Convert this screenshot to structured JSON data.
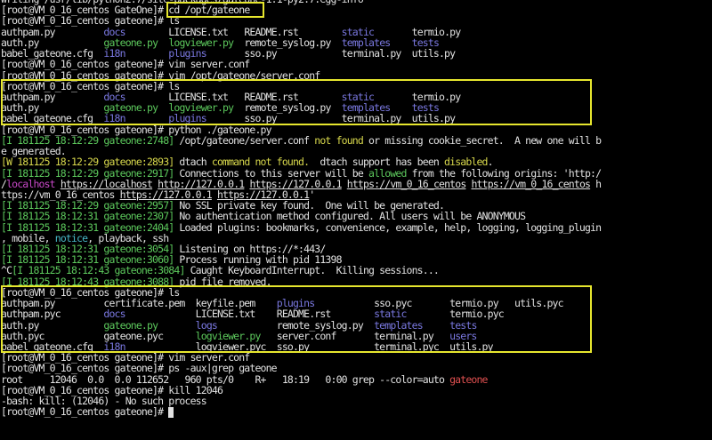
{
  "terminal": {
    "lines": [
      [
        {
          "t": "writing /usr/lib/python2.7/site-packages/gateone-1.1-py2.7.egg-info",
          "c": "w"
        }
      ],
      [
        {
          "t": "[root@VM_0_16_centos GateOne]# ",
          "c": "w"
        },
        {
          "t": "cd /opt/gateone",
          "c": "w"
        }
      ],
      [
        {
          "t": "[root@VM_0_16_centos gateone]# ls",
          "c": "w"
        }
      ],
      [
        {
          "t": "authpam.py         ",
          "c": "w"
        },
        {
          "t": "docs",
          "c": "b"
        },
        {
          "t": "        LICENSE.txt   README.rst        ",
          "c": "w"
        },
        {
          "t": "static",
          "c": "b"
        },
        {
          "t": "       termio.py",
          "c": "w"
        }
      ],
      [
        {
          "t": "auth.py            ",
          "c": "w"
        },
        {
          "t": "gateone.py",
          "c": "g"
        },
        {
          "t": "  ",
          "c": "w"
        },
        {
          "t": "logviewer.py",
          "c": "g"
        },
        {
          "t": "  remote_syslog.py  ",
          "c": "w"
        },
        {
          "t": "templates",
          "c": "b"
        },
        {
          "t": "    ",
          "c": "w"
        },
        {
          "t": "tests",
          "c": "b"
        }
      ],
      [
        {
          "t": "babel_gateone.cfg  ",
          "c": "w"
        },
        {
          "t": "i18n",
          "c": "b"
        },
        {
          "t": "        ",
          "c": "w"
        },
        {
          "t": "plugins",
          "c": "b"
        },
        {
          "t": "       sso.py            terminal.py  utils.py",
          "c": "w"
        }
      ],
      [
        {
          "t": "[root@VM_0_16_centos gateone]# vim server.conf",
          "c": "w"
        }
      ],
      [
        {
          "t": "[root@VM_0_16_centos gateone]# vim /opt/gateone/server.conf",
          "c": "w"
        }
      ],
      [
        {
          "t": "[root@VM_0_16_centos gateone]# ls",
          "c": "w"
        }
      ],
      [
        {
          "t": "authpam.py         ",
          "c": "w"
        },
        {
          "t": "docs",
          "c": "b"
        },
        {
          "t": "        LICENSE.txt   README.rst        ",
          "c": "w"
        },
        {
          "t": "static",
          "c": "b"
        },
        {
          "t": "       termio.py",
          "c": "w"
        }
      ],
      [
        {
          "t": "auth.py            ",
          "c": "w"
        },
        {
          "t": "gateone.py",
          "c": "g"
        },
        {
          "t": "  ",
          "c": "w"
        },
        {
          "t": "logviewer.py",
          "c": "g"
        },
        {
          "t": "  remote_syslog.py  ",
          "c": "w"
        },
        {
          "t": "templates",
          "c": "b"
        },
        {
          "t": "    ",
          "c": "w"
        },
        {
          "t": "tests",
          "c": "b"
        }
      ],
      [
        {
          "t": "babel_gateone.cfg  ",
          "c": "w"
        },
        {
          "t": "i18n",
          "c": "b"
        },
        {
          "t": "        ",
          "c": "w"
        },
        {
          "t": "plugins",
          "c": "b"
        },
        {
          "t": "       sso.py            terminal.py  utils.py",
          "c": "w"
        }
      ],
      [
        {
          "t": "[root@VM_0_16_centos gateone]# python ./gateone.py",
          "c": "w"
        }
      ],
      [
        {
          "t": "[I 181125 18:12:29 gateone:2748]",
          "c": "g"
        },
        {
          "t": " /opt/gateone/server.conf ",
          "c": "w"
        },
        {
          "t": "not found",
          "c": "y"
        },
        {
          "t": " or missing cookie_secret.  A new one will b",
          "c": "w"
        }
      ],
      [
        {
          "t": "e generated.",
          "c": "w"
        }
      ],
      [
        {
          "t": "[W 181125 18:12:29 gateone:2893]",
          "c": "y"
        },
        {
          "t": " dtach ",
          "c": "w"
        },
        {
          "t": "command not found.",
          "c": "y"
        },
        {
          "t": "  dtach support has been ",
          "c": "w"
        },
        {
          "t": "disabled",
          "c": "y"
        },
        {
          "t": ".",
          "c": "w"
        }
      ],
      [
        {
          "t": "[I 181125 18:12:29 gateone:2917]",
          "c": "g"
        },
        {
          "t": " Connections to this server will be ",
          "c": "w"
        },
        {
          "t": "allowed",
          "c": "g"
        },
        {
          "t": " from the following origins: 'http:/",
          "c": "w"
        }
      ],
      [
        {
          "t": "/",
          "c": "w"
        },
        {
          "t": "localhost",
          "c": "m"
        },
        {
          "t": " ",
          "c": "w"
        },
        {
          "t": "https://localhost",
          "c": "w u"
        },
        {
          "t": " ",
          "c": "w"
        },
        {
          "t": "http://127.0.0.1",
          "c": "w u"
        },
        {
          "t": " ",
          "c": "w"
        },
        {
          "t": "https://127.0.0.1",
          "c": "w u"
        },
        {
          "t": " ",
          "c": "w"
        },
        {
          "t": "https://vm_0_16_centos",
          "c": "w u"
        },
        {
          "t": " ",
          "c": "w"
        },
        {
          "t": "https://vm_0_16_centos",
          "c": "w u"
        },
        {
          "t": " h",
          "c": "w"
        }
      ],
      [
        {
          "t": "ttps://vm_0_16_centos ",
          "c": "w"
        },
        {
          "t": "https://127.0.0.1",
          "c": "w u"
        },
        {
          "t": " ",
          "c": "w"
        },
        {
          "t": "https://127.0.0.1",
          "c": "w u"
        },
        {
          "t": "'",
          "c": "w"
        }
      ],
      [
        {
          "t": "[I 181125 18:12:29 gateone:2957]",
          "c": "g"
        },
        {
          "t": " No SSL private key found.  One will be generated.",
          "c": "w"
        }
      ],
      [
        {
          "t": "[I 181125 18:12:31 gateone:2307]",
          "c": "g"
        },
        {
          "t": " No authentication method configured. All users will be ANONYMOUS",
          "c": "w"
        }
      ],
      [
        {
          "t": "[I 181125 18:12:31 gateone:2404]",
          "c": "g"
        },
        {
          "t": " Loaded plugins: bookmarks, convenience, example, help, logging, logging_plugin",
          "c": "w"
        }
      ],
      [
        {
          "t": ", mobile, ",
          "c": "w"
        },
        {
          "t": "notice",
          "c": "c"
        },
        {
          "t": ", playback, ssh",
          "c": "w"
        }
      ],
      [
        {
          "t": "[I 181125 18:12:31 gateone:3054]",
          "c": "g"
        },
        {
          "t": " Listening on https://*:443/",
          "c": "w"
        }
      ],
      [
        {
          "t": "[I 181125 18:12:31 gateone:3060]",
          "c": "g"
        },
        {
          "t": " Process running with pid 11398",
          "c": "w"
        }
      ],
      [
        {
          "t": "^C",
          "c": "w"
        },
        {
          "t": "[I 181125 18:12:43 gateone:3084]",
          "c": "g"
        },
        {
          "t": " Caught KeyboardInterrupt.  Killing sessions...",
          "c": "w"
        }
      ],
      [
        {
          "t": "[I 181125 18:12:43 gateone:3088]",
          "c": "g"
        },
        {
          "t": " pid file removed.",
          "c": "w"
        }
      ],
      [
        {
          "t": "[root@VM_0_16_centos gateone]# ls",
          "c": "w"
        }
      ],
      [
        {
          "t": "authpam.py         certificate.pem  keyfile.pem    ",
          "c": "w"
        },
        {
          "t": "plugins",
          "c": "b"
        },
        {
          "t": "           sso.pyc       termio.py   utils.pyc",
          "c": "w"
        }
      ],
      [
        {
          "t": "authpam.pyc        ",
          "c": "w"
        },
        {
          "t": "docs",
          "c": "b"
        },
        {
          "t": "             LICENSE.txt    README.rst        ",
          "c": "w"
        },
        {
          "t": "static",
          "c": "b"
        },
        {
          "t": "        termio.pyc",
          "c": "w"
        }
      ],
      [
        {
          "t": "auth.py            ",
          "c": "w"
        },
        {
          "t": "gateone.py",
          "c": "g"
        },
        {
          "t": "       ",
          "c": "w"
        },
        {
          "t": "logs",
          "c": "b"
        },
        {
          "t": "           remote_syslog.py  ",
          "c": "w"
        },
        {
          "t": "templates",
          "c": "b"
        },
        {
          "t": "     ",
          "c": "w"
        },
        {
          "t": "tests",
          "c": "b"
        }
      ],
      [
        {
          "t": "auth.pyc           gateone.pyc      ",
          "c": "w"
        },
        {
          "t": "logviewer.py",
          "c": "g"
        },
        {
          "t": "   server.conf       terminal.py   ",
          "c": "w"
        },
        {
          "t": "users",
          "c": "b"
        }
      ],
      [
        {
          "t": "babel_gateone.cfg  ",
          "c": "w"
        },
        {
          "t": "i18n",
          "c": "b"
        },
        {
          "t": "             logviewer.pyc  sso.py            terminal.pyc  utils.py",
          "c": "w"
        }
      ],
      [
        {
          "t": "[root@VM_0_16_centos gateone]# vim server.conf",
          "c": "w"
        }
      ],
      [
        {
          "t": "[root@VM_0_16_centos gateone]# ps -aux|grep gateone",
          "c": "w"
        }
      ],
      [
        {
          "t": "root     12046  0.0  0.0 112652   960 pts/0    R+   18:19   0:00 grep --color=auto ",
          "c": "w"
        },
        {
          "t": "gateone",
          "c": "r"
        }
      ],
      [
        {
          "t": "[root@VM_0_16_centos gateone]# kill 12046",
          "c": "w"
        }
      ],
      [
        {
          "t": "-bash: kill: (12046) - No such process",
          "c": "w"
        }
      ],
      [
        {
          "t": "[root@VM_0_16_centos gateone]# ",
          "c": "w"
        }
      ]
    ],
    "cursor_line": 38,
    "highlight_color": "#e6e62e"
  }
}
